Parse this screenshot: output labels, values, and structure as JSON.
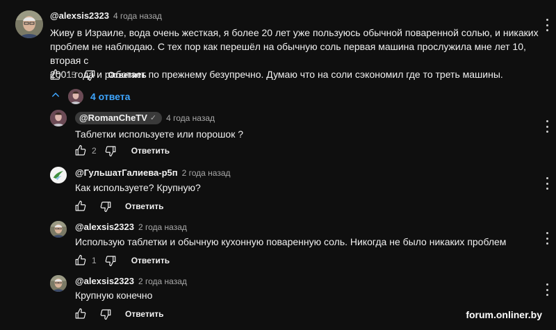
{
  "main_comment": {
    "author": "@alexsis2323",
    "time": "4 года назад",
    "text_line1": "Живу в Израиле, вода очень жесткая,  я более 20 лет уже пользуюсь обычной поваренной солью,  и никаких",
    "text_line2": "проблем не наблюдаю. С тех пор как перешёл на обычную соль  первая машина прослужила мне лет 10, вторая с",
    "text_line3": "2001 года и работает по прежнему безупречно. Думаю что на соли сэкономил где то треть машины.",
    "likes": "15",
    "reply_label": "Ответить"
  },
  "replies_toggle": {
    "label": "4 ответа"
  },
  "replies": [
    {
      "author": "@RomanCheTV",
      "verified": "✓",
      "time": "4 года назад",
      "text": "Таблетки используете или порошок ?",
      "likes": "2",
      "reply_label": "Ответить"
    },
    {
      "author": "@ГульшатГалиева-р5п",
      "time": "2 года назад",
      "text": "Как используете? Крупную?",
      "likes": "",
      "reply_label": "Ответить"
    },
    {
      "author": "@alexsis2323",
      "time": "2 года назад",
      "text": "Использую таблетки и обычную кухонную поваренную соль. Никогда не было никаких проблем",
      "likes": "1",
      "reply_label": "Ответить"
    },
    {
      "author": "@alexsis2323",
      "time": "2 года назад",
      "text": "Крупную конечно",
      "likes": "",
      "reply_label": "Ответить"
    }
  ],
  "watermark": "forum.onliner.by",
  "icons": [
    "like-icon",
    "dislike-icon",
    "more-menu-icon",
    "chevron-up-icon"
  ],
  "colors": {
    "background": "#0f0f0f",
    "link": "#3ea6ff",
    "muted": "#aaaaaa"
  }
}
